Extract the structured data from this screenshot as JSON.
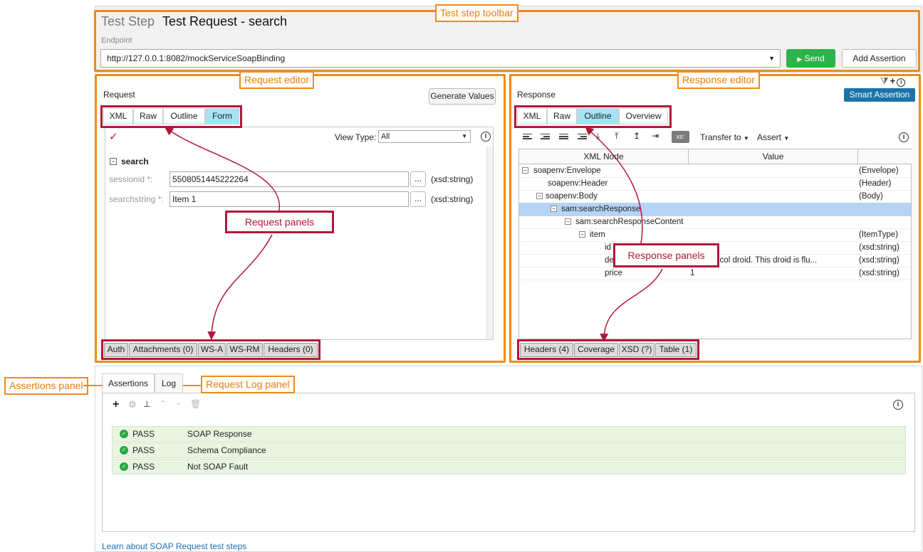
{
  "toolbar": {
    "step_kind": "Test Step",
    "step_name": "Test Request - search",
    "endpoint_label": "Endpoint",
    "endpoint_value": "http://127.0.0.1:8082/mockServiceSoapBinding",
    "send_label": "Send",
    "add_assertion_label": "Add Assertion"
  },
  "request": {
    "title": "Request",
    "generate_values_label": "Generate Values",
    "tabs": [
      "XML",
      "Raw",
      "Outline",
      "Form"
    ],
    "active_tab": "Form",
    "view_type_label": "View Type:",
    "view_type_value": "All",
    "operation": "search",
    "fields": [
      {
        "label": "sessionid *:",
        "value": "5508051445222264",
        "type": "(xsd:string)",
        "browse": "..."
      },
      {
        "label": "searchstring *:",
        "value": "Item 1",
        "type": "(xsd:string)",
        "browse": "..."
      }
    ],
    "bottom_tabs": [
      "Auth",
      "Attachments (0)",
      "WS-A",
      "WS-RM",
      "Headers (0)"
    ]
  },
  "response": {
    "title": "Response",
    "smart_assertion_label": "Smart Assertion",
    "tabs": [
      "XML",
      "Raw",
      "Outline",
      "Overview"
    ],
    "active_tab": "Outline",
    "xs_badge": "xs:",
    "transfer_to_label": "Transfer to",
    "assert_label": "Assert",
    "columns": [
      "XML Node",
      "Value",
      ""
    ],
    "rows": [
      {
        "node": "soapenv:Envelope",
        "value": "",
        "type": "(Envelope)"
      },
      {
        "node": "soapenv:Header",
        "value": "",
        "type": "(Header)"
      },
      {
        "node": "soapenv:Body",
        "value": "",
        "type": "(Body)"
      },
      {
        "node": "sam:searchResponse",
        "value": "",
        "type": ""
      },
      {
        "node": "sam:searchResponseContent",
        "value": "",
        "type": ""
      },
      {
        "node": "item",
        "value": "",
        "type": "(ItemType)"
      },
      {
        "node": "id",
        "value": "",
        "type": "(xsd:string)"
      },
      {
        "node": "de",
        "value": "dy protocol droid. This droid is flu...",
        "type": "(xsd:string)"
      },
      {
        "node": "price",
        "value": "1",
        "type": "(xsd:string)"
      }
    ],
    "bottom_tabs": [
      "Headers (4)",
      "Coverage",
      "XSD (?)",
      "Table (1)"
    ]
  },
  "assertions": {
    "tabs": [
      "Assertions",
      "Log"
    ],
    "items": [
      {
        "status": "PASS",
        "name": "SOAP Response"
      },
      {
        "status": "PASS",
        "name": "Schema Compliance"
      },
      {
        "status": "PASS",
        "name": "Not SOAP Fault"
      }
    ]
  },
  "footer_link": "Learn about SOAP Request test steps",
  "callouts": {
    "toolbar": "Test step toolbar",
    "request_editor": "Request editor",
    "response_editor": "Response editor",
    "assertions_panel": "Assertions panel",
    "request_log_panel": "Request Log panel",
    "request_panels": "Request panels",
    "response_panels": "Response panels"
  },
  "colors": {
    "callout_orange": "#f08a1a",
    "callout_red": "#b3163a",
    "active_tab": "#a6e3f5",
    "send_green": "#2eb24a",
    "smart_assertion_blue": "#1a74a8",
    "pass_green": "#28a745"
  }
}
